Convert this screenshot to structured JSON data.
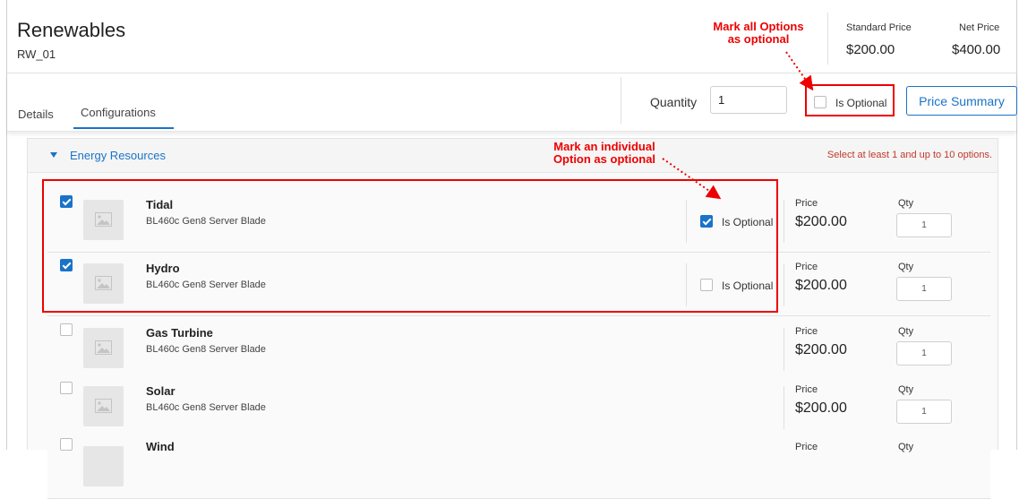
{
  "header": {
    "title": "Renewables",
    "code": "RW_01",
    "standard_price_label": "Standard Price",
    "standard_price": "$200.00",
    "net_price_label": "Net Price",
    "net_price": "$400.00"
  },
  "tabs": [
    {
      "label": "Details",
      "active": false
    },
    {
      "label": "Configurations",
      "active": true
    }
  ],
  "toolbar": {
    "quantity_label": "Quantity",
    "quantity_value": "1",
    "is_optional_label": "Is Optional",
    "is_optional_checked": false,
    "price_summary_label": "Price Summary"
  },
  "group": {
    "title": "Energy Resources",
    "info": "Select at least 1 and up to 10 options."
  },
  "options": [
    {
      "name": "Tidal",
      "desc": "BL460c Gen8 Server Blade",
      "selected": true,
      "is_optional": true,
      "is_optional_label": "Is Optional",
      "price_label": "Price",
      "price": "$200.00",
      "qty_label": "Qty",
      "qty": "1"
    },
    {
      "name": "Hydro",
      "desc": "BL460c Gen8 Server Blade",
      "selected": true,
      "is_optional": false,
      "is_optional_label": "Is Optional",
      "price_label": "Price",
      "price": "$200.00",
      "qty_label": "Qty",
      "qty": "1"
    },
    {
      "name": "Gas Turbine",
      "desc": "BL460c Gen8 Server Blade",
      "selected": false,
      "price_label": "Price",
      "price": "$200.00",
      "qty_label": "Qty",
      "qty": "1"
    },
    {
      "name": "Solar",
      "desc": "BL460c Gen8 Server Blade",
      "selected": false,
      "price_label": "Price",
      "price": "$200.00",
      "qty_label": "Qty",
      "qty": "1"
    },
    {
      "name": "Wind",
      "desc": "",
      "selected": false,
      "price_label": "Price",
      "price": "",
      "qty_label": "Qty",
      "qty": ""
    }
  ],
  "annotations": {
    "all_options": "Mark all Options as optional",
    "individual_option": "Mark an individual Option as optional"
  },
  "colors": {
    "accent": "#1a73c8",
    "annotation": "#e00000",
    "info": "#c0392b"
  },
  "icons": [
    "image-placeholder-icon",
    "caret-down-icon",
    "checkbox-icon"
  ]
}
